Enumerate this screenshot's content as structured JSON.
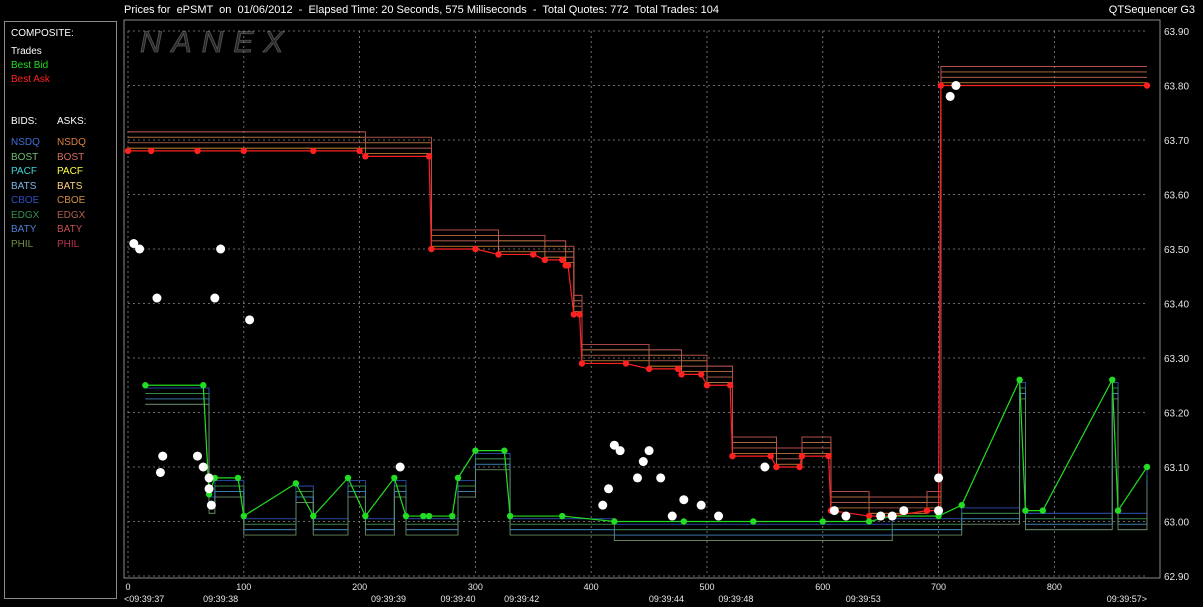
{
  "header": {
    "title": "Prices for  ePSMT  on  01/06/2012  -  Elapsed Time: 20 Seconds, 575 Milliseconds  -  Total Quotes: 772  Total Trades: 104",
    "app_name": "QTSequencer G3",
    "watermark": "NANEX"
  },
  "legend": {
    "composite_label": "COMPOSITE:",
    "trades_label": "Trades",
    "best_bid_label": "Best Bid",
    "best_ask_label": "Best Ask",
    "bids_header": "BIDS:",
    "asks_header": "ASKS:",
    "bids": [
      {
        "label": "NSDQ",
        "color": "#3f6fd8"
      },
      {
        "label": "BOST",
        "color": "#6fbf6f"
      },
      {
        "label": "PACF",
        "color": "#3fd4d4"
      },
      {
        "label": "BATS",
        "color": "#7fb7e8"
      },
      {
        "label": "CBOE",
        "color": "#2f4fbf"
      },
      {
        "label": "EDGX",
        "color": "#2f8f4f"
      },
      {
        "label": "BATY",
        "color": "#4f7fcf"
      },
      {
        "label": "PHIL",
        "color": "#6f8f3f"
      }
    ],
    "asks": [
      {
        "label": "NSDQ",
        "color": "#e07f3f"
      },
      {
        "label": "BOST",
        "color": "#d46f5f"
      },
      {
        "label": "PACF",
        "color": "#ffff40"
      },
      {
        "label": "BATS",
        "color": "#ffd27f"
      },
      {
        "label": "CBOE",
        "color": "#cf8f3f"
      },
      {
        "label": "EDGX",
        "color": "#b05f4f"
      },
      {
        "label": "BATY",
        "color": "#c0504f"
      },
      {
        "label": "PHIL",
        "color": "#c0304f"
      }
    ],
    "colors": {
      "trades": "#ffffff",
      "best_bid": "#22dd22",
      "best_ask": "#ff2020"
    }
  },
  "chart_data": {
    "type": "line",
    "title": "Prices for  ePSMT  on  01/06/2012",
    "ylim": [
      62.9,
      63.9
    ],
    "y_ticks": [
      "63.90",
      "63.80",
      "63.70",
      "63.60",
      "63.50",
      "63.40",
      "63.30",
      "63.20",
      "63.10",
      "63.00",
      "62.90"
    ],
    "xlim": [
      0,
      880
    ],
    "x_ticks": [
      "0",
      "100",
      "200",
      "300",
      "400",
      "500",
      "600",
      "700",
      "800"
    ],
    "time_labels": [
      {
        "x": 0,
        "label": "<09:39:37"
      },
      {
        "x": 80,
        "label": "09:39:38"
      },
      {
        "x": 225,
        "label": "09:39:39"
      },
      {
        "x": 285,
        "label": "09:39:40"
      },
      {
        "x": 340,
        "label": "09:39:42"
      },
      {
        "x": 465,
        "label": "09:39:44"
      },
      {
        "x": 525,
        "label": "09:39:48"
      },
      {
        "x": 635,
        "label": "09:39:53"
      },
      {
        "x": 880,
        "label": "09:39:57>"
      }
    ],
    "series": [
      {
        "name": "Best Ask",
        "color": "#ff2020",
        "points": [
          [
            0,
            63.68
          ],
          [
            20,
            63.68
          ],
          [
            60,
            63.68
          ],
          [
            100,
            63.68
          ],
          [
            160,
            63.68
          ],
          [
            200,
            63.68
          ],
          [
            205,
            63.67
          ],
          [
            260,
            63.67
          ],
          [
            262,
            63.5
          ],
          [
            300,
            63.5
          ],
          [
            320,
            63.49
          ],
          [
            350,
            63.49
          ],
          [
            360,
            63.48
          ],
          [
            375,
            63.48
          ],
          [
            378,
            63.47
          ],
          [
            380,
            63.47
          ],
          [
            385,
            63.38
          ],
          [
            390,
            63.38
          ],
          [
            392,
            63.29
          ],
          [
            430,
            63.29
          ],
          [
            450,
            63.28
          ],
          [
            475,
            63.28
          ],
          [
            478,
            63.27
          ],
          [
            495,
            63.27
          ],
          [
            500,
            63.25
          ],
          [
            520,
            63.25
          ],
          [
            522,
            63.12
          ],
          [
            555,
            63.12
          ],
          [
            560,
            63.1
          ],
          [
            580,
            63.1
          ],
          [
            582,
            63.12
          ],
          [
            605,
            63.12
          ],
          [
            607,
            63.02
          ],
          [
            640,
            63.01
          ],
          [
            650,
            63.01
          ],
          [
            660,
            63.01
          ],
          [
            690,
            63.02
          ],
          [
            700,
            63.02
          ],
          [
            702,
            63.8
          ],
          [
            880,
            63.8
          ]
        ]
      },
      {
        "name": "Best Bid",
        "color": "#22dd22",
        "points": [
          [
            15,
            63.25
          ],
          [
            65,
            63.25
          ],
          [
            70,
            63.05
          ],
          [
            75,
            63.08
          ],
          [
            95,
            63.08
          ],
          [
            100,
            63.01
          ],
          [
            145,
            63.07
          ],
          [
            160,
            63.01
          ],
          [
            190,
            63.08
          ],
          [
            205,
            63.01
          ],
          [
            230,
            63.08
          ],
          [
            240,
            63.01
          ],
          [
            255,
            63.01
          ],
          [
            260,
            63.01
          ],
          [
            280,
            63.01
          ],
          [
            285,
            63.08
          ],
          [
            300,
            63.13
          ],
          [
            325,
            63.13
          ],
          [
            330,
            63.01
          ],
          [
            375,
            63.01
          ],
          [
            420,
            63.0
          ],
          [
            480,
            63.0
          ],
          [
            540,
            63.0
          ],
          [
            600,
            63.0
          ],
          [
            640,
            63.0
          ],
          [
            660,
            63.01
          ],
          [
            700,
            63.01
          ],
          [
            720,
            63.03
          ],
          [
            770,
            63.26
          ],
          [
            775,
            63.02
          ],
          [
            790,
            63.02
          ],
          [
            850,
            63.26
          ],
          [
            855,
            63.02
          ],
          [
            880,
            63.1
          ]
        ]
      },
      {
        "name": "Trades",
        "color": "#ffffff",
        "points": [
          [
            5,
            63.51
          ],
          [
            10,
            63.5
          ],
          [
            25,
            63.41
          ],
          [
            30,
            63.12
          ],
          [
            28,
            63.09
          ],
          [
            60,
            63.12
          ],
          [
            65,
            63.1
          ],
          [
            70,
            63.08
          ],
          [
            80,
            63.5
          ],
          [
            75,
            63.41
          ],
          [
            70,
            63.06
          ],
          [
            72,
            63.03
          ],
          [
            105,
            63.37
          ],
          [
            235,
            63.1
          ],
          [
            410,
            63.03
          ],
          [
            415,
            63.06
          ],
          [
            420,
            63.14
          ],
          [
            425,
            63.13
          ],
          [
            440,
            63.08
          ],
          [
            445,
            63.11
          ],
          [
            450,
            63.13
          ],
          [
            460,
            63.08
          ],
          [
            470,
            63.01
          ],
          [
            480,
            63.04
          ],
          [
            495,
            63.03
          ],
          [
            510,
            63.01
          ],
          [
            550,
            63.1
          ],
          [
            610,
            63.02
          ],
          [
            620,
            63.01
          ],
          [
            650,
            63.01
          ],
          [
            660,
            63.01
          ],
          [
            670,
            63.02
          ],
          [
            700,
            63.02
          ],
          [
            700,
            63.08
          ],
          [
            710,
            63.78
          ],
          [
            715,
            63.8
          ]
        ]
      }
    ]
  }
}
